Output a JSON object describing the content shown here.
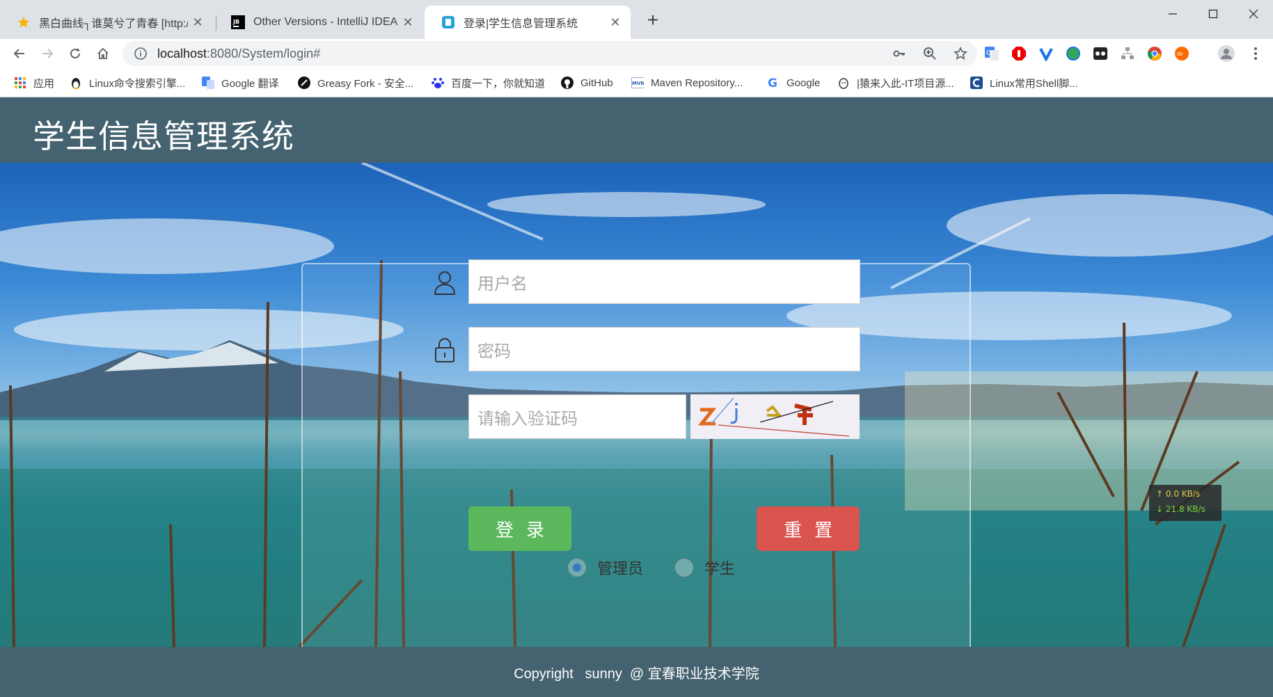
{
  "browser": {
    "tabs": [
      {
        "title": "黑白曲线┐谁莫兮了青春 [http://",
        "icon": "star-favicon"
      },
      {
        "title": "Other Versions - IntelliJ IDEA",
        "icon": "jetbrains-favicon"
      },
      {
        "title": "登录|学生信息管理系统",
        "icon": "site-favicon",
        "active": true
      }
    ],
    "close_glyph": "✕",
    "new_tab_glyph": "+",
    "url_host": "localhost",
    "url_rest": ":8080/System/login#",
    "bookmarks": [
      {
        "label": "应用",
        "icon": "apps-grid-icon"
      },
      {
        "label": "Linux命令搜索引擎...",
        "icon": "penguin-icon"
      },
      {
        "label": "Google 翻译",
        "icon": "google-translate-icon"
      },
      {
        "label": "Greasy Fork - 安全...",
        "icon": "greasyfork-icon"
      },
      {
        "label": "百度一下，你就知道",
        "icon": "baidu-paw-icon"
      },
      {
        "label": "GitHub",
        "icon": "github-icon"
      },
      {
        "label": "Maven Repository...",
        "icon": "maven-icon"
      },
      {
        "label": "Google",
        "icon": "google-g-icon"
      },
      {
        "label": "|猿来入此-IT项目源...",
        "icon": "monkey-icon"
      },
      {
        "label": "Linux常用Shell脚...",
        "icon": "c-logo-icon"
      }
    ]
  },
  "site": {
    "title": "学生信息管理系统",
    "footer": "Copyright   sunny  @ 宜春职业技术学院"
  },
  "login": {
    "username_placeholder": "用户名",
    "password_placeholder": "密码",
    "captcha_placeholder": "请输入验证码",
    "role_admin": "管理员",
    "role_student": "学生",
    "selected_role": "管理员",
    "login_button": "登录",
    "reset_button": "重置"
  },
  "netspeed": {
    "upload": "0.0 KB/s",
    "download": "21.8 KB/s"
  },
  "colors": {
    "header_bg": "#44626f",
    "login_button": "#5cb85c",
    "reset_button": "#d9534f"
  }
}
